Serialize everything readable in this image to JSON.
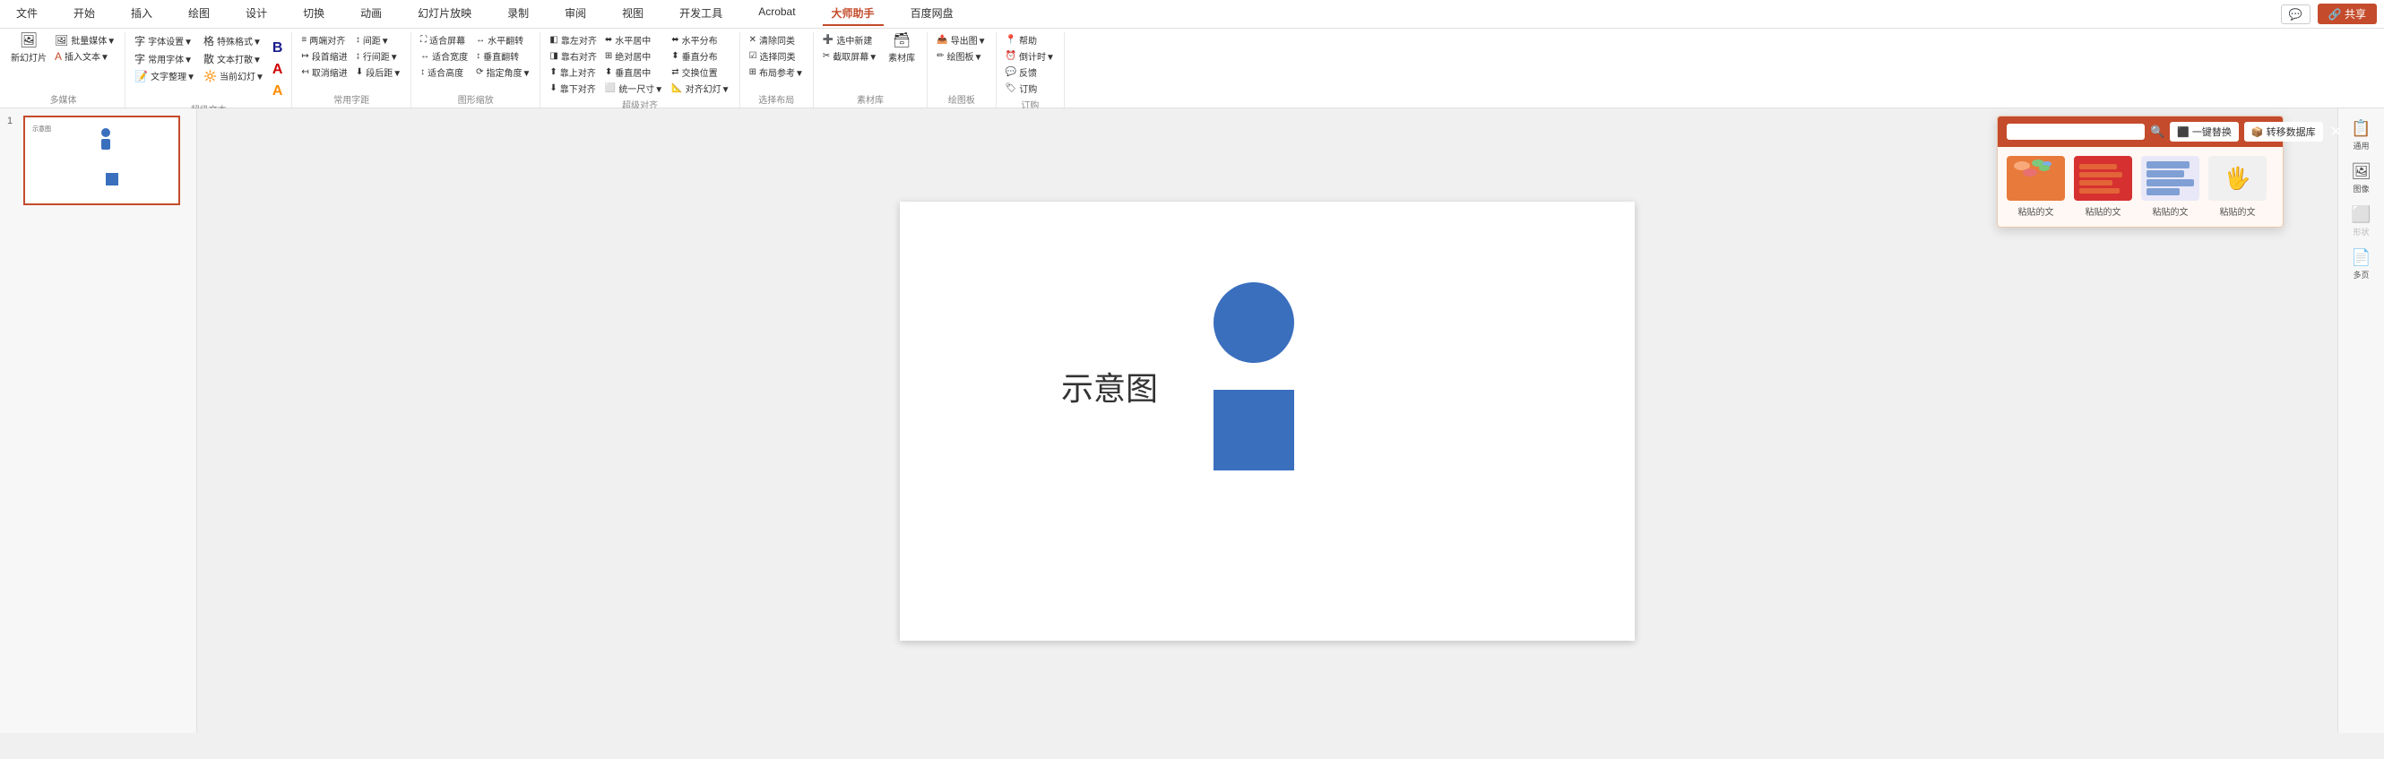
{
  "titlebar": {
    "menus": [
      "文件",
      "开始",
      "插入",
      "绘图",
      "设计",
      "切换",
      "动画",
      "幻灯片放映",
      "录制",
      "审阅",
      "视图",
      "开发工具",
      "Acrobat",
      "大师助手",
      "百度网盘"
    ],
    "active_menu": "大师助手",
    "chat_label": "💬",
    "share_label": "🔗 共享"
  },
  "ribbon": {
    "groups": [
      {
        "name": "多媒体",
        "buttons": [
          {
            "label": "新幻灯片",
            "icon": "🖼"
          },
          {
            "label": "批量媒体",
            "icon": "🖼"
          },
          {
            "label": "插入文本",
            "icon": "A"
          }
        ]
      },
      {
        "name": "超级文本",
        "buttons": [
          {
            "label": "字体设置",
            "icon": "字"
          },
          {
            "label": "常用字体",
            "icon": "字"
          },
          {
            "label": "文字整理",
            "icon": "字"
          },
          {
            "label": "特殊格式",
            "icon": "格"
          },
          {
            "label": "文本打散",
            "icon": "散"
          },
          {
            "label": "当前幻灯",
            "icon": "灯"
          },
          {
            "label": "B",
            "icon": "B"
          },
          {
            "label": "A",
            "icon": "A"
          },
          {
            "label": "A",
            "icon": "A"
          }
        ]
      },
      {
        "name": "常用字距",
        "buttons": [
          {
            "label": "两端对齐",
            "icon": "≡"
          },
          {
            "label": "段首缩进",
            "icon": "↦"
          },
          {
            "label": "取消缩进",
            "icon": "↤"
          },
          {
            "label": "间距▼",
            "icon": "↕"
          },
          {
            "label": "行间距▼",
            "icon": "↨"
          },
          {
            "label": "段后距▼",
            "icon": "⬇"
          }
        ]
      },
      {
        "name": "图形缩放",
        "buttons": [
          {
            "label": "适合屏幕",
            "icon": "⛶"
          },
          {
            "label": "适合宽度",
            "icon": "↔"
          },
          {
            "label": "适合高度",
            "icon": "↕"
          },
          {
            "label": "水平翻转",
            "icon": "↔"
          },
          {
            "label": "垂直翻转",
            "icon": "↕"
          },
          {
            "label": "指定角度▼",
            "icon": "⟳"
          }
        ]
      },
      {
        "name": "超级对齐",
        "buttons": [
          {
            "label": "靠左对齐",
            "icon": "◧"
          },
          {
            "label": "靠右对齐",
            "icon": "◨"
          },
          {
            "label": "靠上对齐",
            "icon": "⬆"
          },
          {
            "label": "靠下对齐",
            "icon": "⬇"
          },
          {
            "label": "水平居中",
            "icon": "⬌"
          },
          {
            "label": "绝对居中",
            "icon": "⊞"
          },
          {
            "label": "垂直居中",
            "icon": "⬍"
          },
          {
            "label": "统一尺寸▼",
            "icon": "⬜"
          },
          {
            "label": "水平分布",
            "icon": "⬌"
          },
          {
            "label": "垂直分布",
            "icon": "⬍"
          },
          {
            "label": "交换位置",
            "icon": "⇄"
          },
          {
            "label": "对齐幻灯▼",
            "icon": "📐"
          }
        ]
      },
      {
        "name": "选择布局",
        "buttons": [
          {
            "label": "清除同类",
            "icon": "✕"
          },
          {
            "label": "选择同类",
            "icon": "☑"
          },
          {
            "label": "布局参考▼",
            "icon": "⊞"
          }
        ]
      },
      {
        "name": "素材库",
        "buttons": [
          {
            "label": "选中新建",
            "icon": "➕"
          },
          {
            "label": "截取屏幕▼",
            "icon": "✂"
          },
          {
            "label": "素材库",
            "icon": "🗃"
          }
        ]
      },
      {
        "name": "绘图板",
        "buttons": [
          {
            "label": "导出图▼",
            "icon": "📤"
          },
          {
            "label": "绘图板▼",
            "icon": "✏"
          }
        ]
      },
      {
        "name": "订购",
        "buttons": [
          {
            "label": "帮助",
            "icon": "📍"
          },
          {
            "label": "倒计时▼",
            "icon": "⏰"
          },
          {
            "label": "反馈",
            "icon": "💬"
          },
          {
            "label": "订购",
            "icon": "🏷"
          }
        ]
      }
    ]
  },
  "sidebar": {
    "items": [
      {
        "label": "通用",
        "icon": "📋",
        "disabled": false
      },
      {
        "label": "图像",
        "icon": "🖼",
        "disabled": false
      },
      {
        "label": "形状",
        "icon": "⬜",
        "disabled": true
      },
      {
        "label": "多页",
        "icon": "📄",
        "disabled": false
      }
    ]
  },
  "popup": {
    "search_placeholder": "",
    "btn1_label": "一键替换",
    "btn2_label": "转移数据库",
    "items": [
      {
        "label": "粘贴的文",
        "color": "orange"
      },
      {
        "label": "粘贴的文",
        "color": "red"
      },
      {
        "label": "粘贴的文",
        "color": "blue"
      },
      {
        "label": "粘贴的文",
        "color": "hand"
      }
    ]
  },
  "canvas": {
    "text": "示意图"
  },
  "slide_number": "1"
}
